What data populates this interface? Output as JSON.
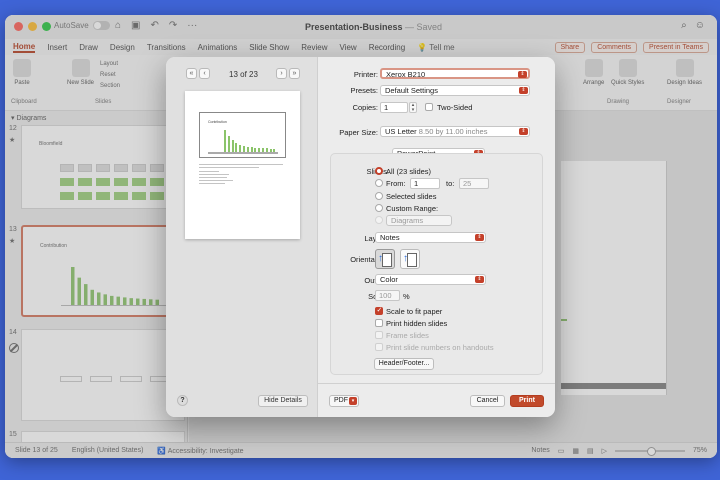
{
  "window": {
    "title": "Presentation-Business",
    "saved_status": "— Saved",
    "autosave_label": "AutoSave",
    "autosave_state": "OFF"
  },
  "ribbon_tabs": [
    "Home",
    "Insert",
    "Draw",
    "Design",
    "Transitions",
    "Animations",
    "Slide Show",
    "Review",
    "View",
    "Recording"
  ],
  "tell_me": "Tell me",
  "share_label": "Share",
  "comments_label": "Comments",
  "present_label": "Present in Teams",
  "ribbon": {
    "paste": "Paste",
    "clipboard": "Clipboard",
    "new_slide": "New Slide",
    "layout": "Layout",
    "reset": "Reset",
    "section": "Section",
    "slides_group": "Slides",
    "arrange": "Arrange",
    "quick_styles": "Quick Styles",
    "drawing_group": "Drawing",
    "designer": "Design Ideas",
    "designer_group": "Designer"
  },
  "leftpane": {
    "section": "Diagrams",
    "slide12_num": "12",
    "slide12_title": "Bloomfield",
    "slide13_num": "13",
    "slide13_title": "Contribution",
    "slide14_num": "14",
    "slide15_num": "15"
  },
  "statusbar": {
    "slide_of": "Slide 13 of 25",
    "language": "English (United States)",
    "accessibility": "Accessibility: Investigate",
    "notes": "Notes",
    "zoom": "75%"
  },
  "preview": {
    "page_indicator": "13 of 23",
    "slide_title": "Contribution"
  },
  "print": {
    "printer_label": "Printer:",
    "printer_value": "Xerox B210",
    "presets_label": "Presets:",
    "presets_value": "Default Settings",
    "copies_label": "Copies:",
    "copies_value": "1",
    "two_sided_label": "Two-Sided",
    "paper_size_label": "Paper Size:",
    "paper_size_value": "US Letter",
    "paper_size_dims": "8.50 by 11.00 inches",
    "app_section": "PowerPoint",
    "slides_label": "Slides:",
    "all_label": "All",
    "all_count": "(23 slides)",
    "from_label": "From:",
    "from_value": "1",
    "to_label": "to:",
    "to_value": "25",
    "selected_slides": "Selected slides",
    "custom_range": "Custom Range:",
    "diagrams_value": "Diagrams",
    "layout_label": "Layout:",
    "layout_value": "Notes",
    "orientation_label": "Orientation:",
    "output_label": "Output:",
    "output_value": "Color",
    "scale_label": "Scale:",
    "scale_value": "100",
    "scale_unit": "%",
    "scale_to_fit": "Scale to fit paper",
    "print_hidden": "Print hidden slides",
    "frame_slides": "Frame slides",
    "print_numbers": "Print slide numbers on handouts",
    "header_footer": "Header/Footer...",
    "help": "?",
    "hide_details": "Hide Details",
    "pdf": "PDF",
    "cancel": "Cancel",
    "print_button": "Print"
  },
  "chart_preview": {
    "values": [
      100,
      72,
      55,
      40,
      33,
      28,
      24,
      22,
      20,
      18,
      17,
      16,
      15,
      14
    ]
  },
  "colors": {
    "accent": "#c4402a",
    "desktop": "#3f64d6",
    "bar_green": "#8bc46a"
  }
}
